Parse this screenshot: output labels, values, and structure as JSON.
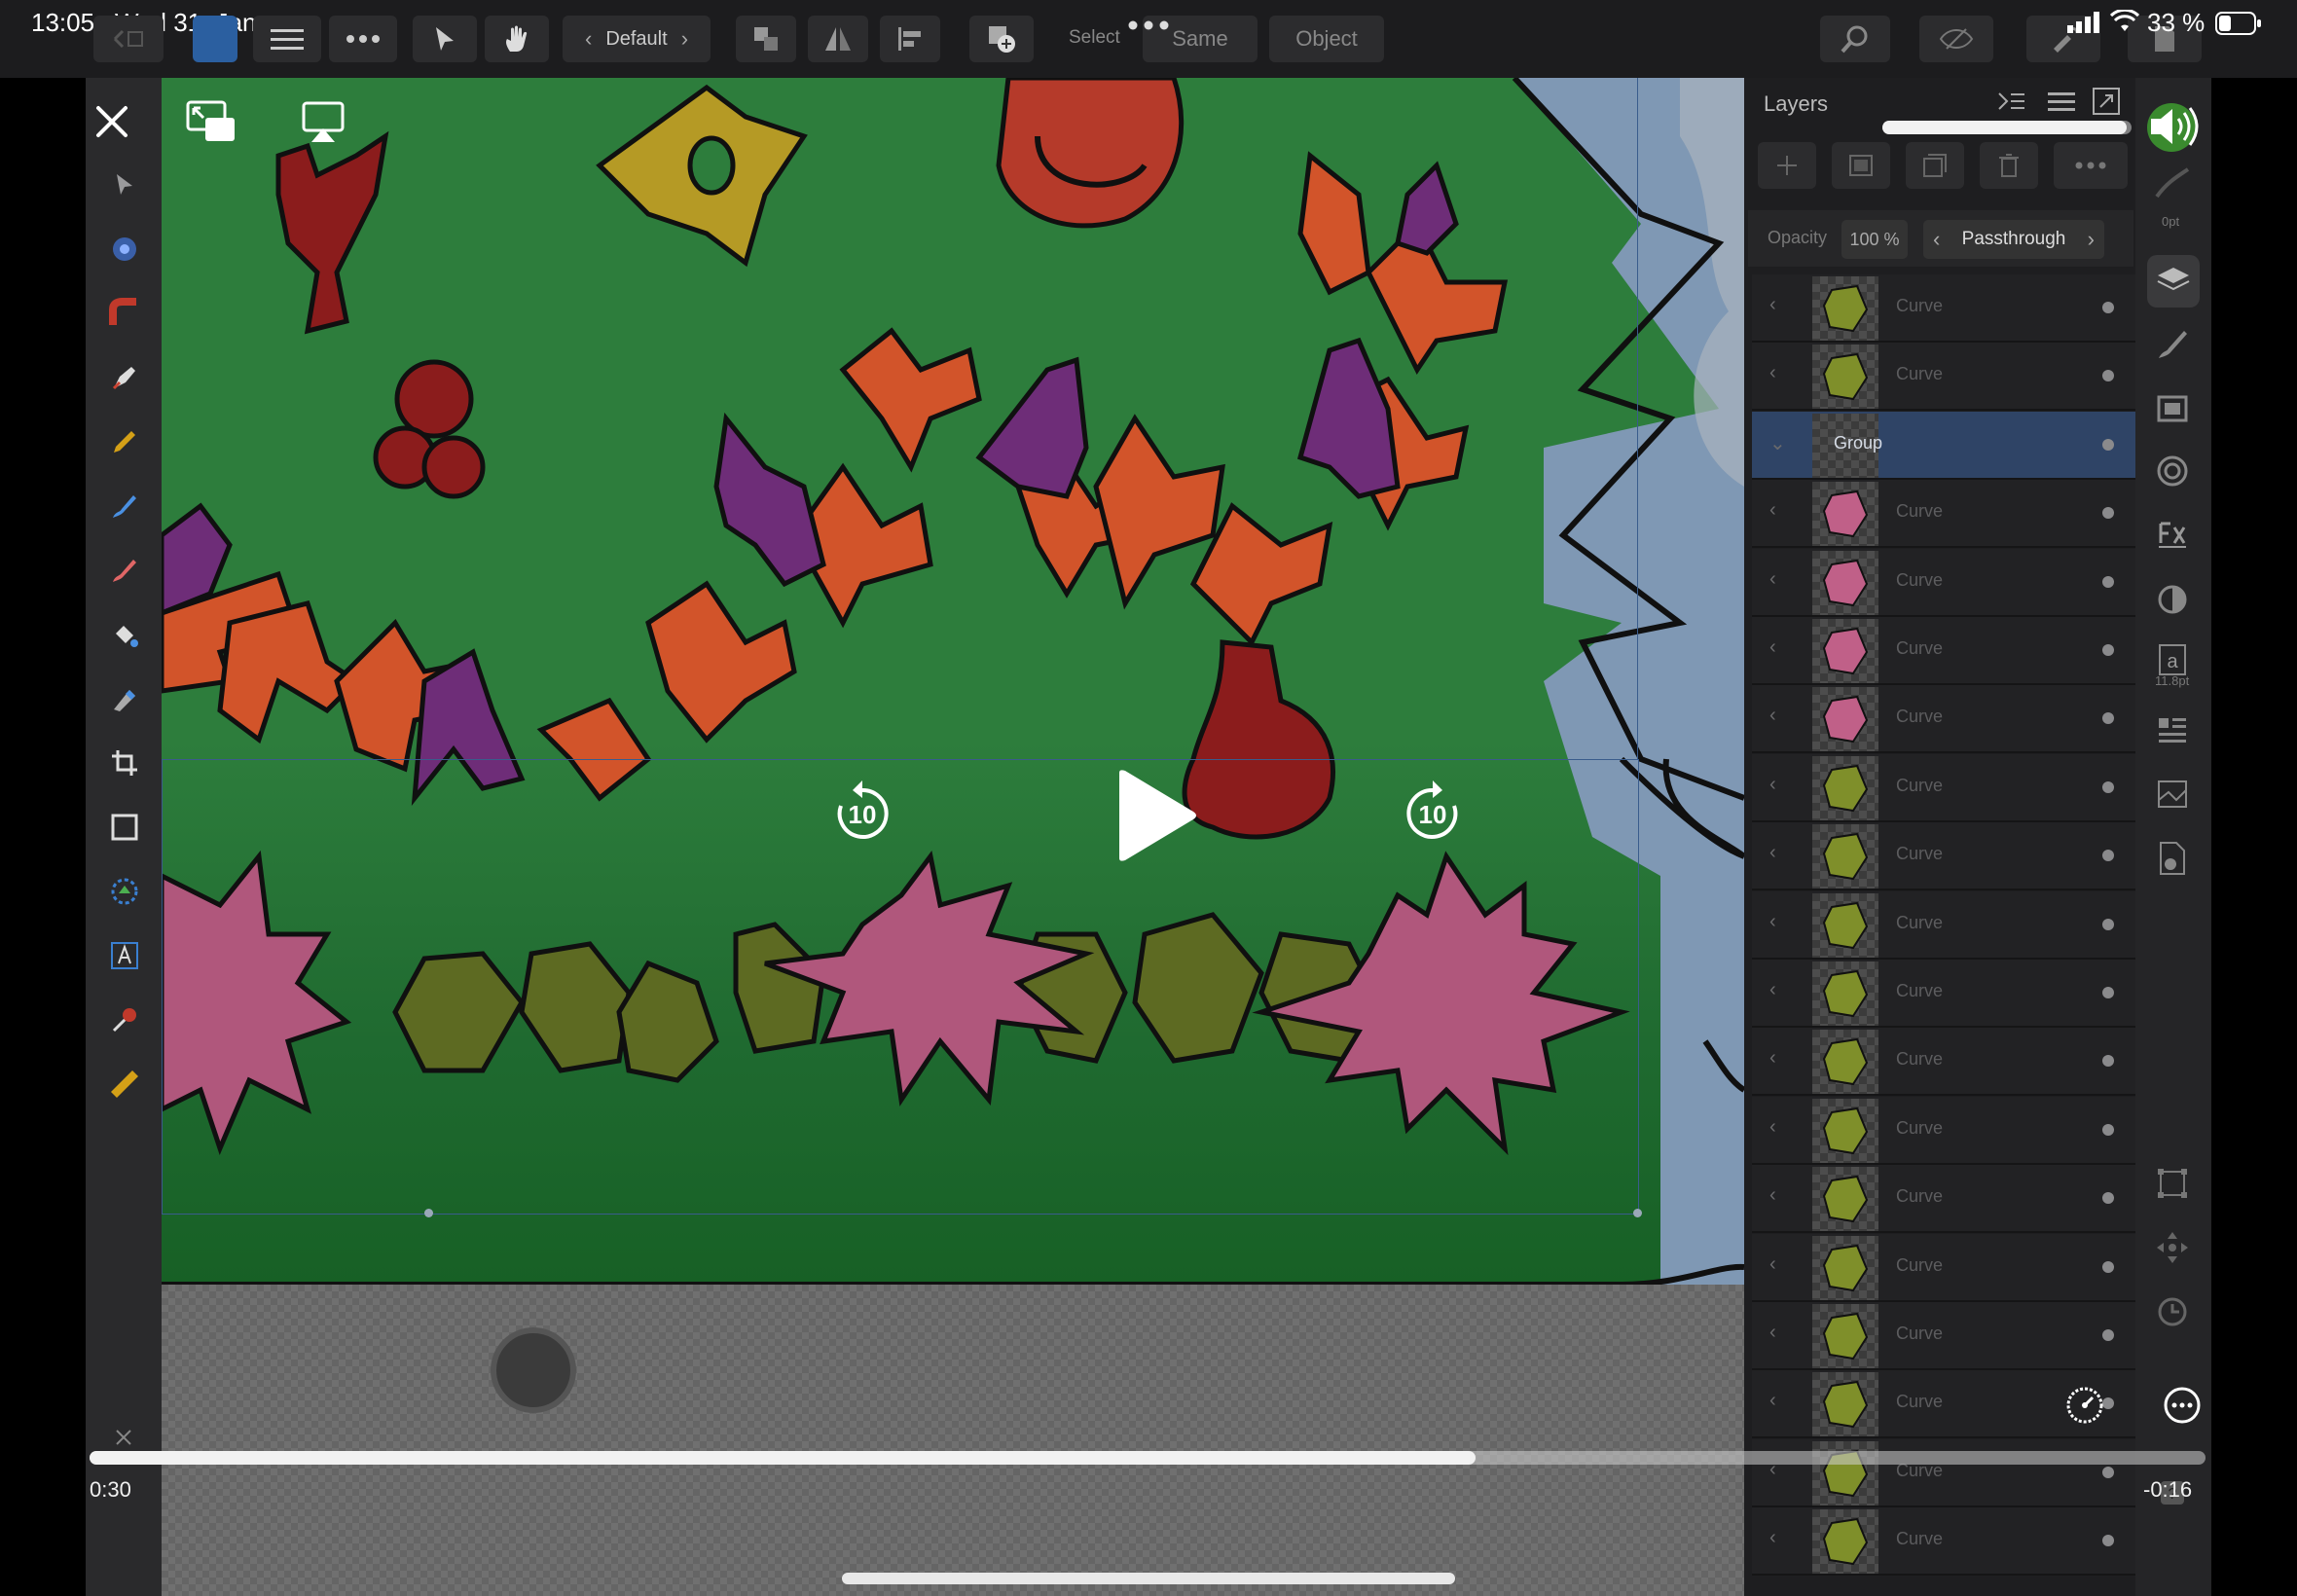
{
  "status": {
    "time": "13:05",
    "date": "Wed 31. Jan",
    "battery": "33 %"
  },
  "toolbar": {
    "preset": "Default",
    "select_label": "Select",
    "same_label": "Same",
    "object_label": "Object"
  },
  "layers_panel": {
    "title": "Layers",
    "opacity_label": "Opacity",
    "opacity_value": "100 %",
    "blend_mode": "Passthrough",
    "rows": [
      {
        "name": "Curve",
        "thumb": "#7f8f2a"
      },
      {
        "name": "Curve",
        "thumb": "#7f8f2a"
      },
      {
        "name": "Group",
        "thumb": "",
        "selected": true
      },
      {
        "name": "Curve",
        "thumb": "#c06088"
      },
      {
        "name": "Curve",
        "thumb": "#c06088"
      },
      {
        "name": "Curve",
        "thumb": "#c06088"
      },
      {
        "name": "Curve",
        "thumb": "#c06088"
      },
      {
        "name": "Curve",
        "thumb": "#7f8f2a"
      },
      {
        "name": "Curve",
        "thumb": "#7f8f2a"
      },
      {
        "name": "Curve",
        "thumb": "#7f8f2a"
      },
      {
        "name": "Curve",
        "thumb": "#7f8f2a"
      },
      {
        "name": "Curve",
        "thumb": "#7f8f2a"
      },
      {
        "name": "Curve",
        "thumb": "#7f8f2a"
      },
      {
        "name": "Curve",
        "thumb": "#7f8f2a"
      },
      {
        "name": "Curve",
        "thumb": "#7f8f2a"
      },
      {
        "name": "Curve",
        "thumb": "#7f8f2a"
      },
      {
        "name": "Curve",
        "thumb": "#7f8f2a"
      },
      {
        "name": "Curve",
        "thumb": "#7f8f2a"
      },
      {
        "name": "Curve",
        "thumb": "#7f8f2a"
      }
    ]
  },
  "right_column": {
    "stroke_width": "0pt",
    "font_size": "11.8pt"
  },
  "video": {
    "elapsed": "0:30",
    "remaining": "-0:16",
    "progress": 0.655,
    "skip_back_seconds": "10",
    "skip_forward_seconds": "10"
  },
  "colors": {
    "tree_green": "#2d7d3c",
    "orange": "#d2542a",
    "purple": "#6e2d78",
    "dark_red": "#8b1c1c",
    "pink": "#b0577c",
    "olive": "#5d6a22",
    "yellow": "#b59a25",
    "sky": "#7f98b4",
    "selection_blue": "#2f4466"
  }
}
